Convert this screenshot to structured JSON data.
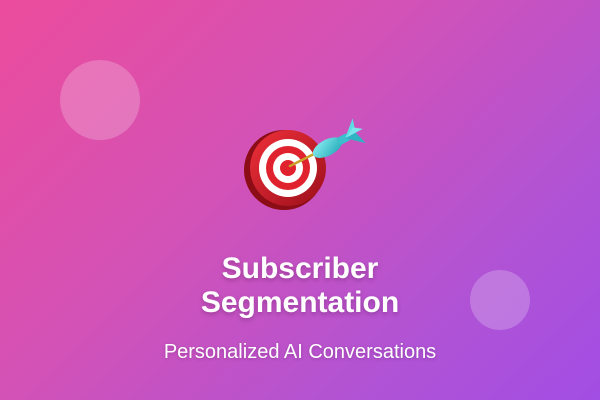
{
  "icons": {
    "hero": "target-with-dart-icon"
  },
  "colors": {
    "gradient_start": "#ec4c9c",
    "gradient_end": "#a24de4",
    "target_red": "#d91e2b",
    "dart_teal": "#4fd1d9"
  },
  "title": {
    "line1": "Subscriber",
    "line2": "Segmentation"
  },
  "subtitle": "Personalized AI Conversations"
}
